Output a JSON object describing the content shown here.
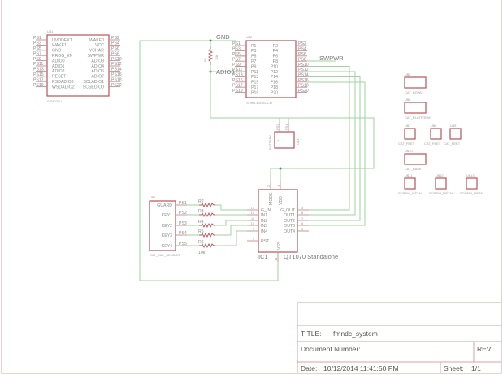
{
  "colors": {
    "component": "#b5545a",
    "pin": "#c98a8e",
    "wire": "#9fd39f",
    "junction": "#3a9a3a",
    "frame": "#d8a0a4"
  },
  "title_block": {
    "title_label": "TITLE:",
    "title_value": "fmndc_system",
    "doc_label": "Document Number:",
    "rev_label": "REV:",
    "date_label": "Date:",
    "date_value": "10/12/2014 11:41:50 PM",
    "sheet_label": "Sheet:",
    "sheet_value": "1/1"
  },
  "u1": {
    "name": "U$1",
    "value": "SFM020U",
    "left_pins": [
      "PS1",
      "PS3",
      "PS5",
      "PS7",
      "PS9",
      "PS11",
      "PS13",
      "PS15",
      "PS17",
      "PS19"
    ],
    "left_labels": [
      "UVDDEXT",
      "WAKE1",
      "GND",
      "PROG_EN",
      "ADIO0",
      "ADIO1",
      "ADIO2",
      "RESET",
      "RSDADIO3",
      "WSDADIO2"
    ],
    "right_pins": [
      "PS2",
      "PS4",
      "PS6",
      "PS8",
      "PS10",
      "PS12",
      "PS14",
      "PS16",
      "PS18",
      "PS20"
    ],
    "right_labels": [
      "WAKE0",
      "VCC",
      "VCHAR",
      "SWPWR",
      "ADIO3",
      "ADIO4",
      "ADIO6",
      "ADIO7",
      "SCLADIO1",
      "SCSEDIO0"
    ]
  },
  "u2": {
    "name": "U$2",
    "value": "SFM0-119-01-L-D",
    "left_pins": [
      "PS1",
      "PS3",
      "PS5",
      "PS7",
      "PS9",
      "PS11",
      "PS13",
      "PS15",
      "PS17",
      "PS19"
    ],
    "left_labels": [
      "P1",
      "P3",
      "P5",
      "P7",
      "P9",
      "P11",
      "P13",
      "P15",
      "P17",
      "P19"
    ],
    "right_pins": [
      "PS2",
      "PS4",
      "PS6",
      "PS8",
      "PS10",
      "PS12",
      "PS14",
      "PS16",
      "PS18",
      "PS20"
    ],
    "right_labels": [
      "P2",
      "P4",
      "P6",
      "P8",
      "P10",
      "P12",
      "P14",
      "P16",
      "P18",
      "P20"
    ]
  },
  "nets": {
    "gnd": "GND",
    "adio0": "ADIO0",
    "swpwr": "SWPWR"
  },
  "r1": {
    "name": "R1",
    "value": "10k"
  },
  "u3": {
    "name": "U$3",
    "value": "BATTERY",
    "pins": [
      "PS2",
      "PS1"
    ],
    "labels": [
      "+",
      "-"
    ]
  },
  "u4": {
    "name": "U$4",
    "value": "CAT_CAP_SENSOR",
    "labels": [
      "GUARD",
      "KEY1",
      "KEY2",
      "KEY3",
      "KEY4"
    ],
    "pins": [
      "PS1",
      "PS2",
      "PS3",
      "PS4",
      "PS5"
    ]
  },
  "resistors": {
    "names": [
      "R2",
      "R3",
      "R4",
      "R5",
      "R6"
    ],
    "values": [
      "10k",
      "10k",
      "10k",
      "10k",
      "10k"
    ]
  },
  "ic1": {
    "name": "IC1",
    "value": "QT1070 Standalone",
    "left_labels": [
      "G_IN",
      "IN1",
      "IN2",
      "IN3",
      "IN4",
      "RST"
    ],
    "left_nums": [
      "13",
      "12",
      "11",
      "10",
      "9",
      "4"
    ],
    "right_labels": [
      "G_OUT",
      "OUT1",
      "OUT2",
      "OUT3",
      "OUT4"
    ],
    "right_nums": [
      "3",
      "8",
      "7",
      "6",
      "5"
    ],
    "top_labels": [
      "MODE",
      "VDD"
    ],
    "top_nums": [
      "2",
      "1"
    ],
    "bottom_label": "VSS",
    "bottom_num": "14"
  },
  "parts": [
    {
      "name": "U$5",
      "value": "CAT_BOWL"
    },
    {
      "name": "U$6",
      "value": "CAT_PLATFORM"
    },
    {
      "name": "U$7",
      "value": "CAT_FEET"
    },
    {
      "name": "U$8",
      "value": "CAT_FEET"
    },
    {
      "name": "U$9",
      "value": "CAT_FEET"
    },
    {
      "name": "U$10",
      "value": "CAT_BASE"
    },
    {
      "name": "U$11",
      "value": "SCREW_METAL"
    },
    {
      "name": "U$12",
      "value": "SCREW_METAL"
    },
    {
      "name": "U$13",
      "value": "SCREW_METAL"
    }
  ]
}
